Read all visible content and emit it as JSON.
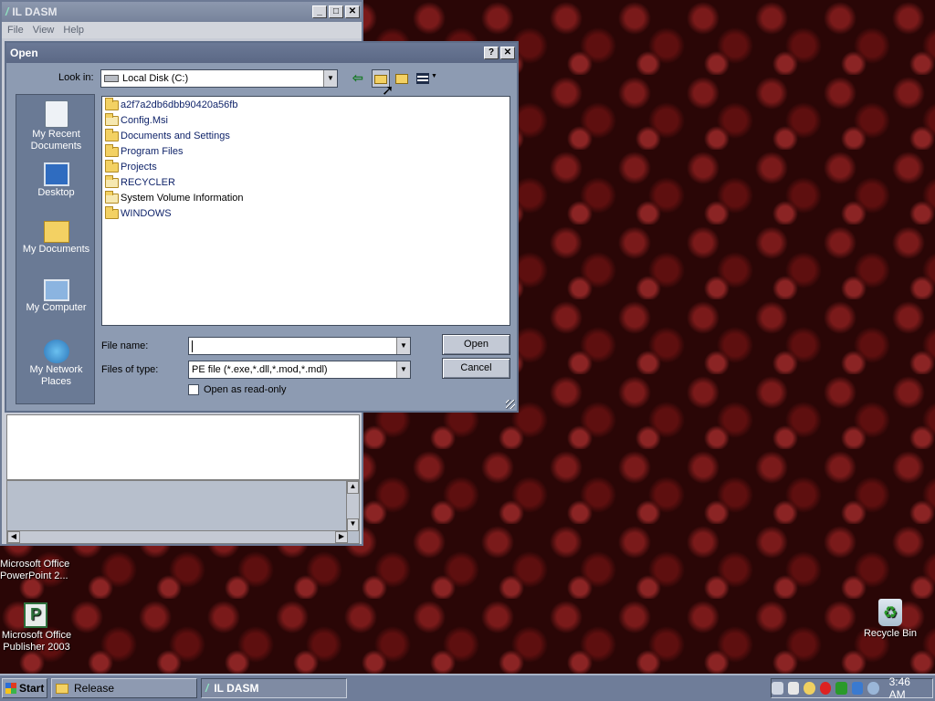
{
  "ildasm": {
    "title": "IL DASM",
    "menu": [
      "File",
      "View",
      "Help"
    ]
  },
  "dialog": {
    "title": "Open",
    "look_in_label": "Look in:",
    "look_in_value": "Local Disk (C:)",
    "places": [
      {
        "label": "My Recent Documents",
        "icon": "recent-documents-icon"
      },
      {
        "label": "Desktop",
        "icon": "desktop-icon"
      },
      {
        "label": "My Documents",
        "icon": "my-documents-icon"
      },
      {
        "label": "My Computer",
        "icon": "my-computer-icon"
      },
      {
        "label": "My Network Places",
        "icon": "network-places-icon"
      }
    ],
    "files": [
      "a2f7a2db6dbb90420a56fb",
      "Config.Msi",
      "Documents and Settings",
      "Program Files",
      "Projects",
      "RECYCLER",
      "System Volume Information",
      "WINDOWS"
    ],
    "file_name_label": "File name:",
    "file_name_value": "",
    "file_type_label": "Files of type:",
    "file_type_value": "PE file (*.exe,*.dll,*.mod,*.mdl)",
    "read_only_label": "Open as read-only",
    "open_button": "Open",
    "cancel_button": "Cancel"
  },
  "desktop_icons": [
    {
      "label": "Microsoft Office PowerPoint 2...",
      "icon": "powerpoint-icon"
    },
    {
      "label": "Microsoft Office Publisher 2003",
      "icon": "publisher-icon"
    },
    {
      "label": "Recycle Bin",
      "icon": "recycle-bin-icon"
    }
  ],
  "taskbar": {
    "start": "Start",
    "tasks": [
      "Release",
      "IL DASM"
    ],
    "clock": "3:46 AM"
  },
  "colors": {
    "title_active": "#5b6885",
    "folder": "#f3d163",
    "desktop": "#2a0606"
  }
}
